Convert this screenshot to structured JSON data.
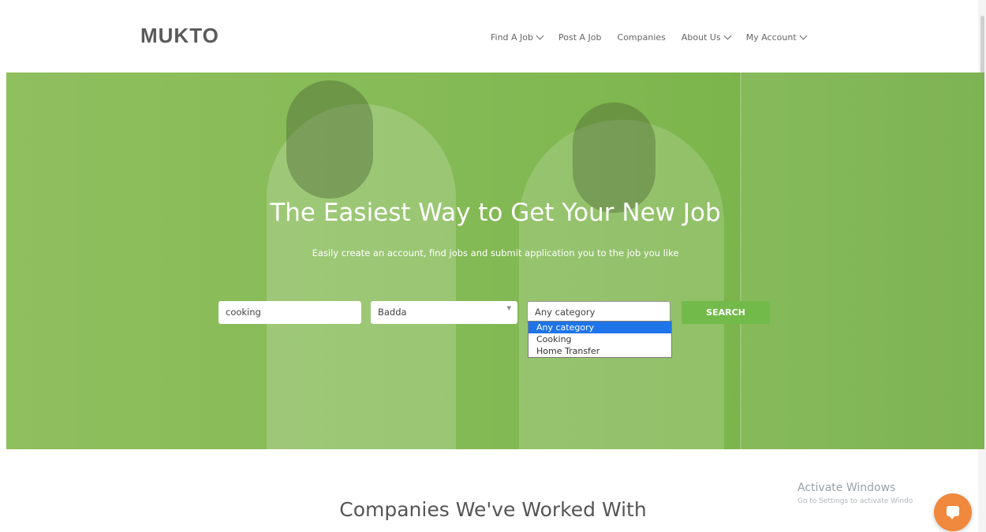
{
  "header": {
    "logo": "MUKTO",
    "nav": [
      {
        "label": "Find A Job",
        "has_dropdown": true
      },
      {
        "label": "Post A Job",
        "has_dropdown": false
      },
      {
        "label": "Companies",
        "has_dropdown": false
      },
      {
        "label": "About Us",
        "has_dropdown": true
      },
      {
        "label": "My Account",
        "has_dropdown": true
      }
    ]
  },
  "hero": {
    "title": "The Easiest Way to Get Your New Job",
    "subtitle": "Easily create an account, find jobs and submit application you to the job you like",
    "search": {
      "keyword_value": "cooking",
      "location_value": "Badda",
      "category_value": "Any category",
      "category_options": [
        "Any category",
        "Cooking",
        "Home Transfer"
      ],
      "category_selected_index": 0,
      "button_label": "SEARCH"
    },
    "accent_color": "#72bb4a"
  },
  "companies": {
    "title": "Companies We've Worked With"
  },
  "watermark": {
    "title": "Activate Windows",
    "subtitle": "Go to Settings to activate Windo"
  },
  "chat": {
    "icon": "chat-bubble-icon",
    "color": "#f0883e"
  }
}
